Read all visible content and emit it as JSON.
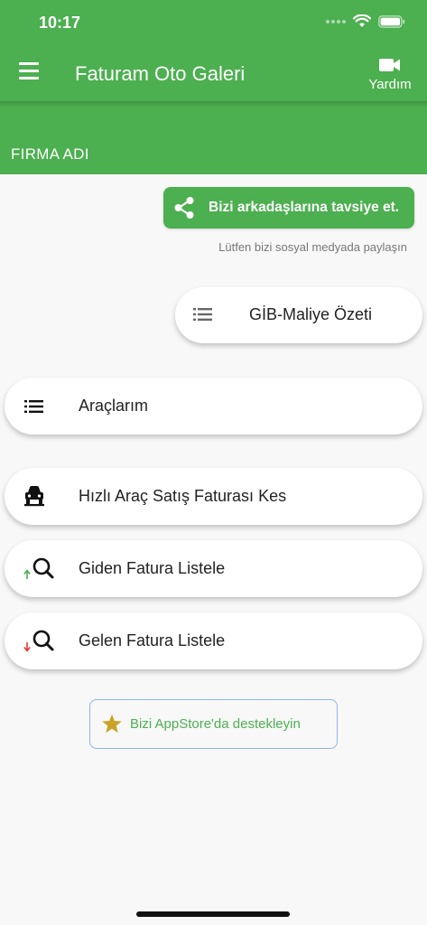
{
  "status_bar": {
    "time": "10:17"
  },
  "app_bar": {
    "title": "Faturam Oto Galeri",
    "help_label": "Yardım"
  },
  "company": {
    "name": "FIRMA ADI"
  },
  "share": {
    "button_label": "Bizi arkadaşlarına tavsiye et.",
    "hint": "Lütfen bizi sosyal medyada paylaşın"
  },
  "menu": {
    "gib_summary": "GİB-Maliye Özeti",
    "vehicles": "Araçlarım",
    "quick_sale_invoice": "Hızlı Araç Satış Faturası Kes",
    "outgoing_invoices": "Giden Fatura Listele",
    "incoming_invoices": "Gelen Fatura Listele"
  },
  "support": {
    "label": "Bizi AppStore'da destekleyin"
  },
  "colors": {
    "primary": "#4caf50",
    "background": "#f8f8f8",
    "star": "#c9a227",
    "arrow_up": "#4caf50",
    "arrow_down": "#e53935",
    "support_border": "#8fb4e8"
  },
  "icons": {
    "menu": "menu-icon",
    "help": "video-camera-icon",
    "share": "share-icon",
    "list": "list-icon",
    "car": "car-icon",
    "search_up": "search-arrow-up-icon",
    "search_down": "search-arrow-down-icon",
    "star": "star-icon"
  }
}
